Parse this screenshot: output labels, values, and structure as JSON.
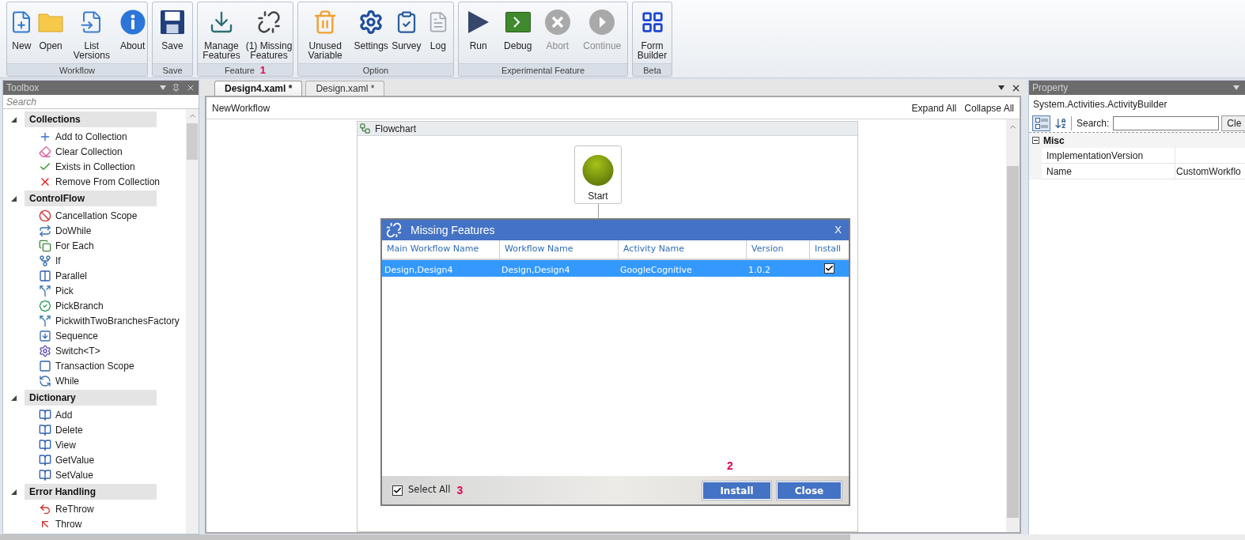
{
  "ribbon": {
    "groups": [
      {
        "label": "Workflow",
        "buttons": [
          {
            "label": "New",
            "disabled": false
          },
          {
            "label": "Open",
            "disabled": false
          },
          {
            "label": "List Versions",
            "disabled": false
          },
          {
            "label": "About",
            "disabled": false
          }
        ]
      },
      {
        "label": "Save",
        "buttons": [
          {
            "label": "Save",
            "disabled": false
          }
        ]
      },
      {
        "label": "Feature",
        "marker": "1",
        "buttons": [
          {
            "label": "Manage Features",
            "disabled": false
          },
          {
            "label": "(1) Missing Features",
            "disabled": false
          }
        ]
      },
      {
        "label": "Option",
        "buttons": [
          {
            "label": "Unused Variable",
            "disabled": false
          },
          {
            "label": "Settings",
            "disabled": false
          },
          {
            "label": "Survey",
            "disabled": false
          },
          {
            "label": "Log",
            "disabled": false
          }
        ]
      },
      {
        "label": "Experimental Feature",
        "buttons": [
          {
            "label": "Run",
            "disabled": false
          },
          {
            "label": "Debug",
            "disabled": false
          },
          {
            "label": "Abort",
            "disabled": true
          },
          {
            "label": "Continue",
            "disabled": true
          }
        ]
      },
      {
        "label": "Beta",
        "buttons": [
          {
            "label": "Form Builder",
            "disabled": false
          }
        ]
      }
    ]
  },
  "toolbox": {
    "title": "Toolbox",
    "search": {
      "placeholder": "Search"
    },
    "categories": [
      {
        "label": "Collections",
        "expanded": true,
        "children": [
          {
            "label": "Add to Collection"
          },
          {
            "label": "Clear Collection"
          },
          {
            "label": "Exists in Collection"
          },
          {
            "label": "Remove From Collection"
          }
        ]
      },
      {
        "label": "ControlFlow",
        "expanded": true,
        "children": [
          {
            "label": "Cancellation Scope"
          },
          {
            "label": "DoWhile"
          },
          {
            "label": "For Each"
          },
          {
            "label": "If"
          },
          {
            "label": "Parallel"
          },
          {
            "label": "Pick"
          },
          {
            "label": "PickBranch"
          },
          {
            "label": "PickwithTwoBranchesFactory"
          },
          {
            "label": "Sequence"
          },
          {
            "label": "Switch<T>"
          },
          {
            "label": "Transaction Scope"
          },
          {
            "label": "While"
          }
        ]
      },
      {
        "label": "Dictionary",
        "expanded": true,
        "children": [
          {
            "label": "Add"
          },
          {
            "label": "Delete"
          },
          {
            "label": "View"
          },
          {
            "label": "GetValue"
          },
          {
            "label": "SetValue"
          }
        ]
      },
      {
        "label": "Error Handling",
        "expanded": true,
        "children": [
          {
            "label": "ReThrow"
          },
          {
            "label": "Throw"
          }
        ]
      }
    ]
  },
  "designer": {
    "tabs": [
      {
        "label": "Design4.xaml *",
        "selected": true
      },
      {
        "label": "Design.xaml *",
        "selected": false
      }
    ],
    "breadcrumb": "NewWorkflow",
    "actions": [
      "Expand All",
      "Collapse All"
    ],
    "flowchart": {
      "title": "Flowchart",
      "start_node": {
        "label": "Start"
      }
    },
    "dialog": {
      "title": "Missing Features",
      "close": "X",
      "columns": [
        "Main Workflow Name",
        "Workflow Name",
        "Activity Name",
        "Version",
        "Install"
      ],
      "rows": [
        {
          "cells": [
            "Design,Design4",
            "Design,Design4",
            "GoogleCognitive",
            "1.0.2"
          ],
          "install": true,
          "selected": true
        }
      ],
      "select_all": {
        "label": "Select All",
        "checked": true,
        "marker": "3"
      },
      "buttons": [
        {
          "label": "Install",
          "marker": "2"
        },
        {
          "label": "Close"
        }
      ]
    }
  },
  "property": {
    "title": "Property",
    "object": "System.Activities.ActivityBuilder",
    "search": {
      "label": "Search:"
    },
    "clear_button": "Cle",
    "categories": [
      {
        "label": "Misc",
        "expanded": true,
        "rows": [
          {
            "name": "ImplementationVersion"
          },
          {
            "name": "Name",
            "value": "CustomWorkflo"
          }
        ]
      }
    ]
  }
}
